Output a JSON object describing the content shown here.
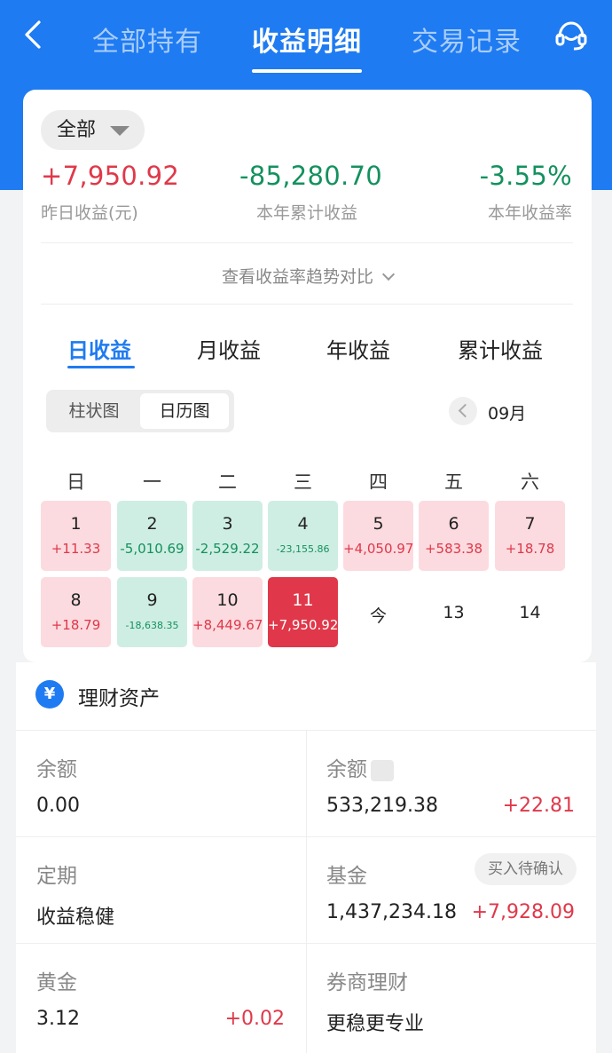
{
  "header": {
    "tabs": [
      {
        "label": "全部持有"
      },
      {
        "label": "收益明细"
      },
      {
        "label": "交易记录"
      }
    ]
  },
  "filter": {
    "label": "全部"
  },
  "stats": [
    {
      "value": "+7,950.92",
      "label": "昨日收益(元)",
      "tone": "red"
    },
    {
      "value": "-85,280.70",
      "label": "本年累计收益",
      "tone": "green"
    },
    {
      "value": "-3.55%",
      "label": "本年收益率",
      "tone": "green"
    }
  ],
  "compare_label": "查看收益率趋势对比",
  "period_tabs": [
    {
      "label": "日收益"
    },
    {
      "label": "月收益"
    },
    {
      "label": "年收益"
    },
    {
      "label": "累计收益"
    }
  ],
  "view_toggle": {
    "bar": "柱状图",
    "calendar": "日历图"
  },
  "month_label": "09月",
  "weekdays": [
    "日",
    "一",
    "二",
    "三",
    "四",
    "五",
    "六"
  ],
  "calendar": [
    {
      "day": "1",
      "value": "+11.33"
    },
    {
      "day": "2",
      "value": "-5,010.69"
    },
    {
      "day": "3",
      "value": "-2,529.22"
    },
    {
      "day": "4",
      "value": "-23,155.86"
    },
    {
      "day": "5",
      "value": "+4,050.97"
    },
    {
      "day": "6",
      "value": "+583.38"
    },
    {
      "day": "7",
      "value": "+18.78"
    },
    {
      "day": "8",
      "value": "+18.79"
    },
    {
      "day": "9",
      "value": "-18,638.35"
    },
    {
      "day": "10",
      "value": "+8,449.67"
    },
    {
      "day": "11",
      "value": "+7,950.92"
    },
    {
      "day": "今",
      "value": ""
    },
    {
      "day": "13",
      "value": ""
    },
    {
      "day": "14",
      "value": ""
    }
  ],
  "assets": {
    "title": "理财资产",
    "items": [
      {
        "title": "余额",
        "value": "0.00",
        "change": ""
      },
      {
        "title": "余额",
        "value": "533,219.38",
        "change": "+22.81"
      },
      {
        "title": "定期",
        "value": "收益稳健",
        "change": ""
      },
      {
        "title": "基金",
        "value": "1,437,234.18",
        "change": "+7,928.09",
        "badge": "买入待确认"
      },
      {
        "title": "黄金",
        "value": "3.12",
        "change": "+0.02"
      },
      {
        "title": "券商理财",
        "value": "更稳更专业",
        "change": ""
      }
    ]
  },
  "colors": {
    "brand": "#1f7bf1",
    "gain": "#e0384a",
    "loss": "#13915e"
  },
  "icons": {
    "back": "chevron-left-icon",
    "service": "headset-icon",
    "currency": "yen-icon"
  }
}
